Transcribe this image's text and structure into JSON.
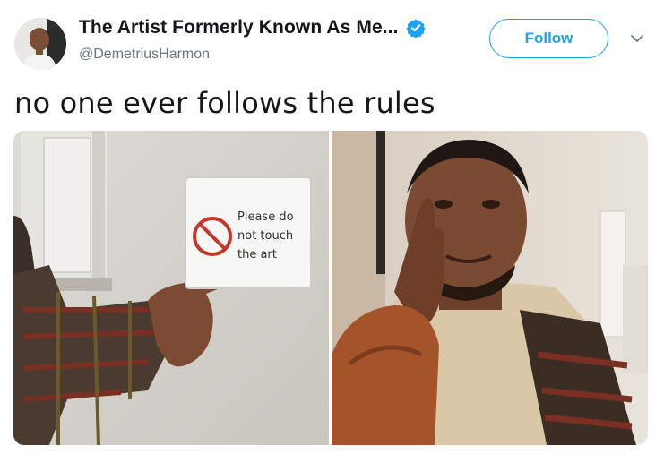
{
  "author": {
    "display_name": "The Artist Formerly Known As Me...",
    "handle": "@DemetriusHarmon",
    "verified": true,
    "avatar_icon": "profile-photo"
  },
  "actions": {
    "follow_label": "Follow",
    "more_icon": "chevron-down-icon"
  },
  "tweet": {
    "text": "no one ever follows the rules"
  },
  "media": {
    "left_photo": {
      "sign_text": [
        "Please do",
        "not touch",
        "the art"
      ],
      "sign_icon": "no-symbol"
    },
    "right_photo": {}
  },
  "colors": {
    "accent": "#1da1f2",
    "text": "#14171a",
    "secondary_text": "#657786"
  }
}
